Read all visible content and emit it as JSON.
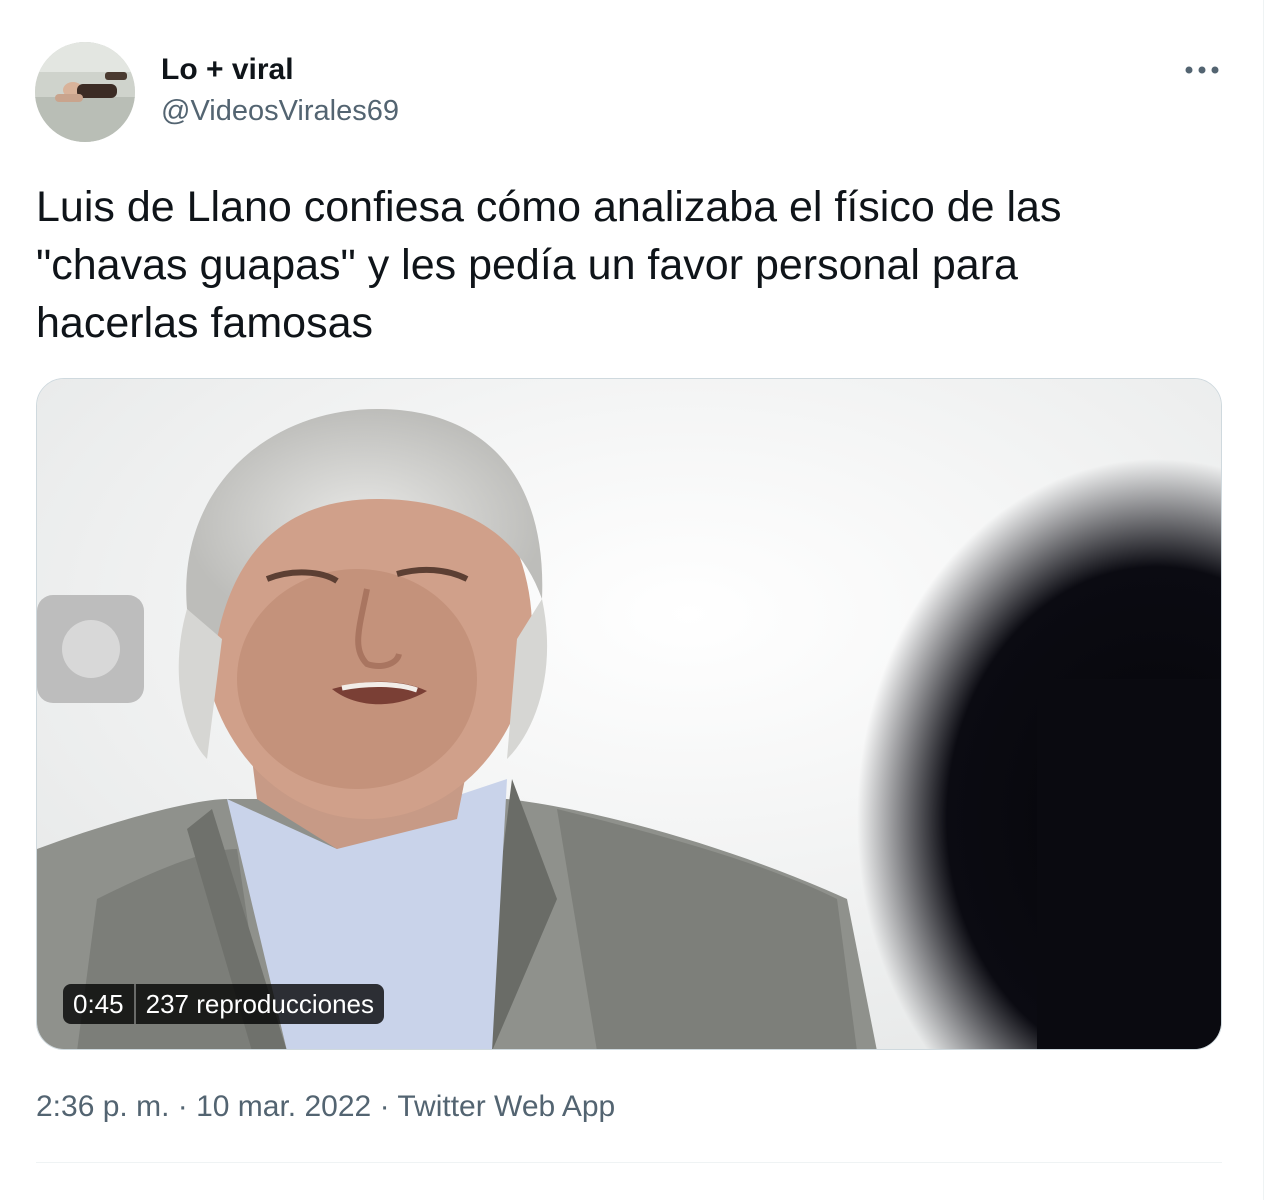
{
  "tweet": {
    "author": {
      "display_name": "Lo + viral",
      "handle": "@VideosVirales69",
      "avatar_icon": "avatar-photo"
    },
    "more_icon": "more-dots-icon",
    "text_lines": [
      "Luis de Llano confiesa cómo analizaba el físico de las",
      "\"chavas guapas\" y les pedía un favor personal para",
      "hacerlas famosas"
    ],
    "video": {
      "duration": "0:45",
      "views": "237 reproducciones"
    },
    "meta": {
      "time": "2:36 p. m.",
      "separator": "·",
      "date": "10 mar. 2022",
      "source": "Twitter Web App"
    }
  },
  "colors": {
    "text_primary": "#0f1419",
    "text_secondary": "#536471",
    "border": "#cfd9de",
    "divider": "#eff3f4"
  }
}
